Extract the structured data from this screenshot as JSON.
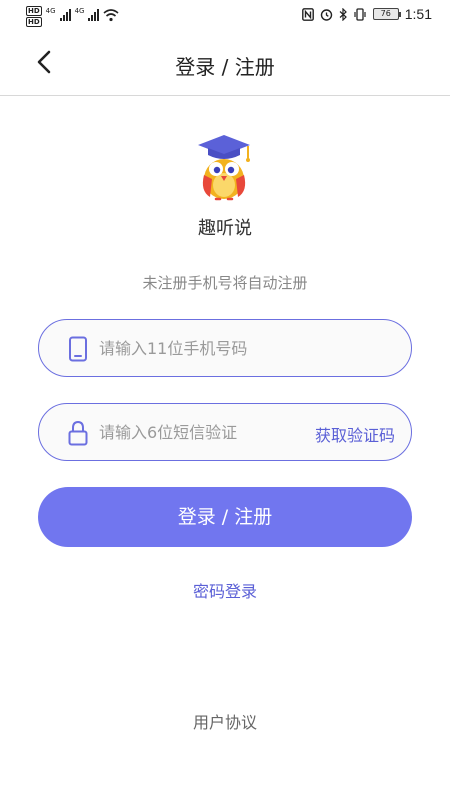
{
  "status_bar": {
    "hd1": "HD",
    "hd2": "HD",
    "net1": "4G",
    "net2": "4G",
    "battery": "76",
    "time": "1:51"
  },
  "nav": {
    "title": "登录 / 注册"
  },
  "app": {
    "name": "趣听说"
  },
  "hint": "未注册手机号将自动注册",
  "phone_field": {
    "placeholder": "请输入11位手机号码",
    "value": ""
  },
  "code_field": {
    "placeholder": "请输入6位短信验证",
    "value": "",
    "get_code_label": "获取验证码"
  },
  "login_button": "登录 / 注册",
  "password_login": "密码登录",
  "user_agreement": "用户协议",
  "colors": {
    "accent": "#7176ef",
    "link": "#5a5fd6",
    "border": "#6b6fe0"
  }
}
